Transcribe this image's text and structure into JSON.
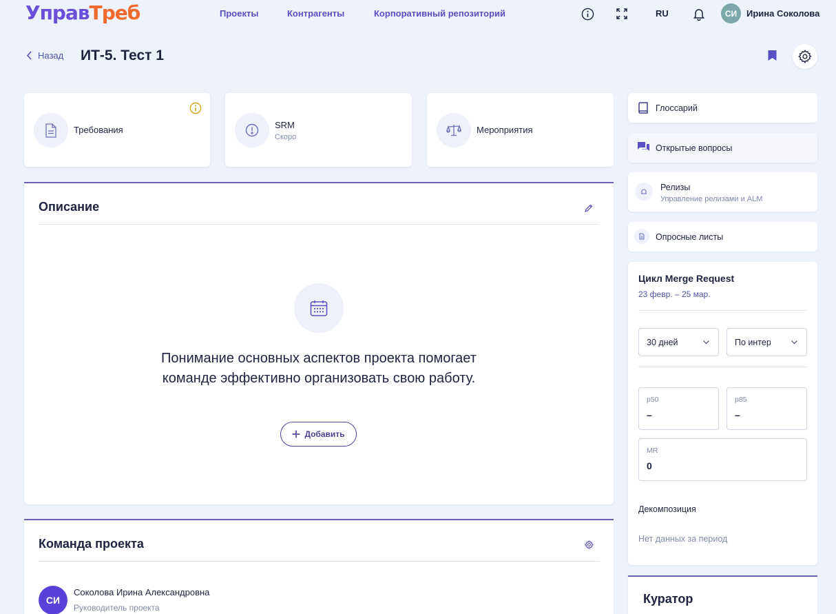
{
  "header": {
    "logo_part1": "Управ",
    "logo_part2": "Треб",
    "nav": [
      "Проекты",
      "Контрагенты",
      "Корпоративный репозиторий"
    ],
    "lang": "RU",
    "avatar_initials": "СИ",
    "user_name": "Ирина Соколова"
  },
  "title_row": {
    "back_label": "Назад",
    "page_title": "ИТ-5. Тест 1"
  },
  "tiles": [
    {
      "label": "Требования",
      "sub": ""
    },
    {
      "label": "SRM",
      "sub": "Скоро"
    },
    {
      "label": "Мероприятия",
      "sub": ""
    }
  ],
  "description": {
    "title": "Описание",
    "empty_text": "Понимание основных аспектов проекта помогает команде эффективно организовать свою работу.",
    "add_label": "Добавить"
  },
  "team": {
    "title": "Команда проекта",
    "members": [
      {
        "initials": "СИ",
        "name": "Соколова Ирина Александровна",
        "role": "Руководитель проекта"
      }
    ]
  },
  "sidebar": {
    "links": [
      {
        "label": "Глоссарий",
        "sub": "",
        "icon": "book-icon"
      },
      {
        "label": "Открытые вопросы",
        "sub": "",
        "icon": "chat-icon"
      },
      {
        "label": "Релизы",
        "sub": "Управление релизами и ALM",
        "icon": "release-icon"
      },
      {
        "label": "Опросные листы",
        "sub": "",
        "icon": "survey-icon"
      }
    ],
    "merge_request": {
      "title": "Цикл Merge Request",
      "dates": "23 февр. – 25 мар.",
      "period_select": "30 дней",
      "mode_select": "По интервалам",
      "p50_label": "p50",
      "p50_value": "–",
      "p85_label": "p85",
      "p85_value": "–",
      "mr_label": "MR",
      "mr_value": "0",
      "decomposition_label": "Декомпозиция",
      "no_data": "Нет данных за период"
    },
    "curator_title": "Куратор"
  },
  "colors": {
    "accent": "#5a4ec4",
    "logo_orange": "#ef6a2c",
    "background": "#eef2fa"
  }
}
